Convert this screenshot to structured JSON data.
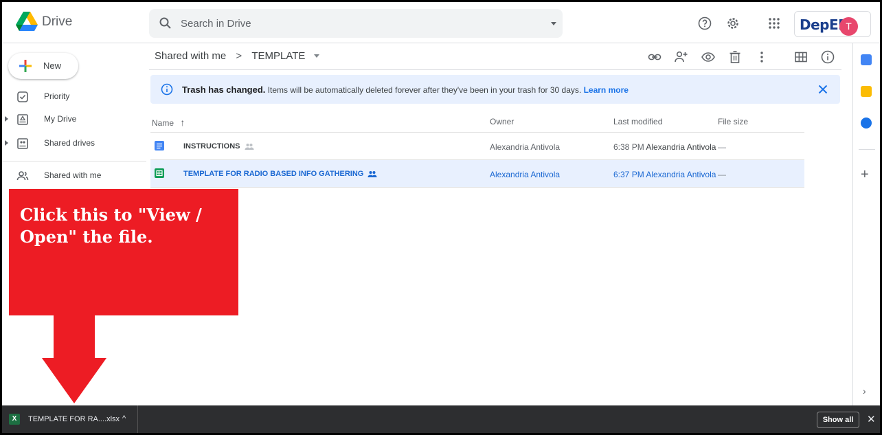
{
  "app": {
    "brand": "Drive",
    "search_placeholder": "Search in Drive",
    "deped_logo_text": "DepED",
    "avatar_initial": "T"
  },
  "sidebar": {
    "new_label": "New",
    "items": [
      {
        "label": "Priority",
        "icon": "checkbox-icon"
      },
      {
        "label": "My Drive",
        "icon": "my-drive-icon"
      },
      {
        "label": "Shared drives",
        "icon": "shared-drives-icon"
      },
      {
        "label": "Shared with me",
        "icon": "people-icon"
      }
    ]
  },
  "breadcrumb": {
    "parent": "Shared with me",
    "separator": ">",
    "current": "TEMPLATE"
  },
  "notice": {
    "title": "Trash has changed.",
    "body": " Items will be automatically deleted forever after they've been in your trash for 30 days. ",
    "link": "Learn more"
  },
  "table": {
    "columns": {
      "name": "Name",
      "owner": "Owner",
      "modified": "Last modified",
      "size": "File size"
    },
    "sort_arrow": "↑",
    "rows": [
      {
        "name": "INSTRUCTIONS",
        "type": "doc",
        "owner": "Alexandria Antivola",
        "modified_time": "6:38 PM",
        "modified_by": "Alexandria Antivola",
        "size": "—",
        "selected": false
      },
      {
        "name": "TEMPLATE FOR RADIO BASED INFO GATHERING",
        "type": "sheet",
        "owner": "Alexandria Antivola",
        "modified_time": "6:37 PM",
        "modified_by": "Alexandria Antivola",
        "size": "—",
        "selected": true
      }
    ]
  },
  "callout": {
    "text": "Click this to \"View / Open\" the file."
  },
  "download_bar": {
    "file_name": "TEMPLATE FOR RA....xlsx",
    "caret": "^",
    "show_all": "Show all",
    "close": "✕"
  },
  "side_panel": {
    "plus": "+",
    "chevron": "›"
  },
  "colors": {
    "accent_blue": "#1a73e8",
    "selected_row": "#e8f0fe",
    "callout_red": "#ed1c24",
    "download_bar": "#2d2e30"
  }
}
